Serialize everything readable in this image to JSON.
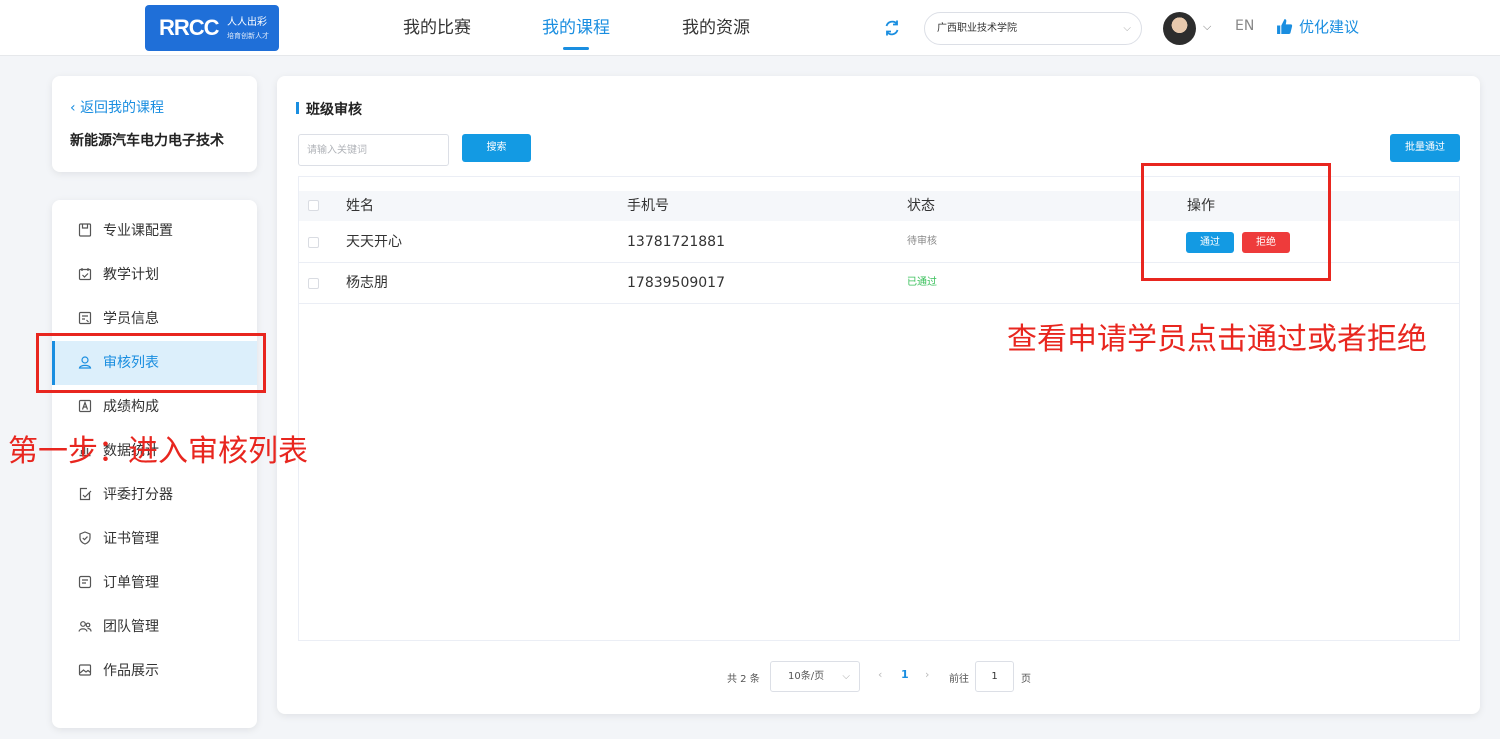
{
  "header": {
    "logo_text": "RRCC",
    "logo_sub1": "人人出彩",
    "logo_sub2": "培育创新人才",
    "nav": [
      "我的比赛",
      "我的课程",
      "我的资源"
    ],
    "school": "广西职业技术学院",
    "lang": "EN",
    "suggest": "优化建议"
  },
  "sidebar": {
    "back": "返回我的课程",
    "course": "新能源汽车电力电子技术",
    "items": [
      {
        "label": "专业课配置",
        "icon": "document-icon"
      },
      {
        "label": "教学计划",
        "icon": "calendar-icon"
      },
      {
        "label": "学员信息",
        "icon": "id-card-icon"
      },
      {
        "label": "审核列表",
        "icon": "user-audit-icon"
      },
      {
        "label": "成绩构成",
        "icon": "grade-icon"
      },
      {
        "label": "数据统计",
        "icon": "bar-chart-icon"
      },
      {
        "label": "评委打分器",
        "icon": "scoring-icon"
      },
      {
        "label": "证书管理",
        "icon": "shield-icon"
      },
      {
        "label": "订单管理",
        "icon": "order-icon"
      },
      {
        "label": "团队管理",
        "icon": "team-icon"
      },
      {
        "label": "作品展示",
        "icon": "image-icon"
      }
    ],
    "active_index": 3
  },
  "main": {
    "title": "班级审核",
    "search_placeholder": "请输入关键词",
    "search_btn": "搜索",
    "batch_btn": "批量通过",
    "columns": [
      "姓名",
      "手机号",
      "状态",
      "操作"
    ],
    "rows": [
      {
        "name": "天天开心",
        "phone": "13781721881",
        "status": "待审核",
        "actions": [
          "通过",
          "拒绝"
        ]
      },
      {
        "name": "杨志朋",
        "phone": "17839509017",
        "status": "已通过"
      }
    ],
    "pagination": {
      "total": "共 2 条",
      "size": "10条/页",
      "current": "1",
      "goto": "前往",
      "goto_value": "1",
      "page": "页"
    }
  },
  "annotations": {
    "step1": "第一步：进入审核列表",
    "step2": "查看申请学员点击通过或者拒绝"
  },
  "colors": {
    "accent": "#1a8ee0",
    "reject": "#ee3b3b",
    "passed": "#39c05b",
    "annotation": "#e8261f"
  }
}
